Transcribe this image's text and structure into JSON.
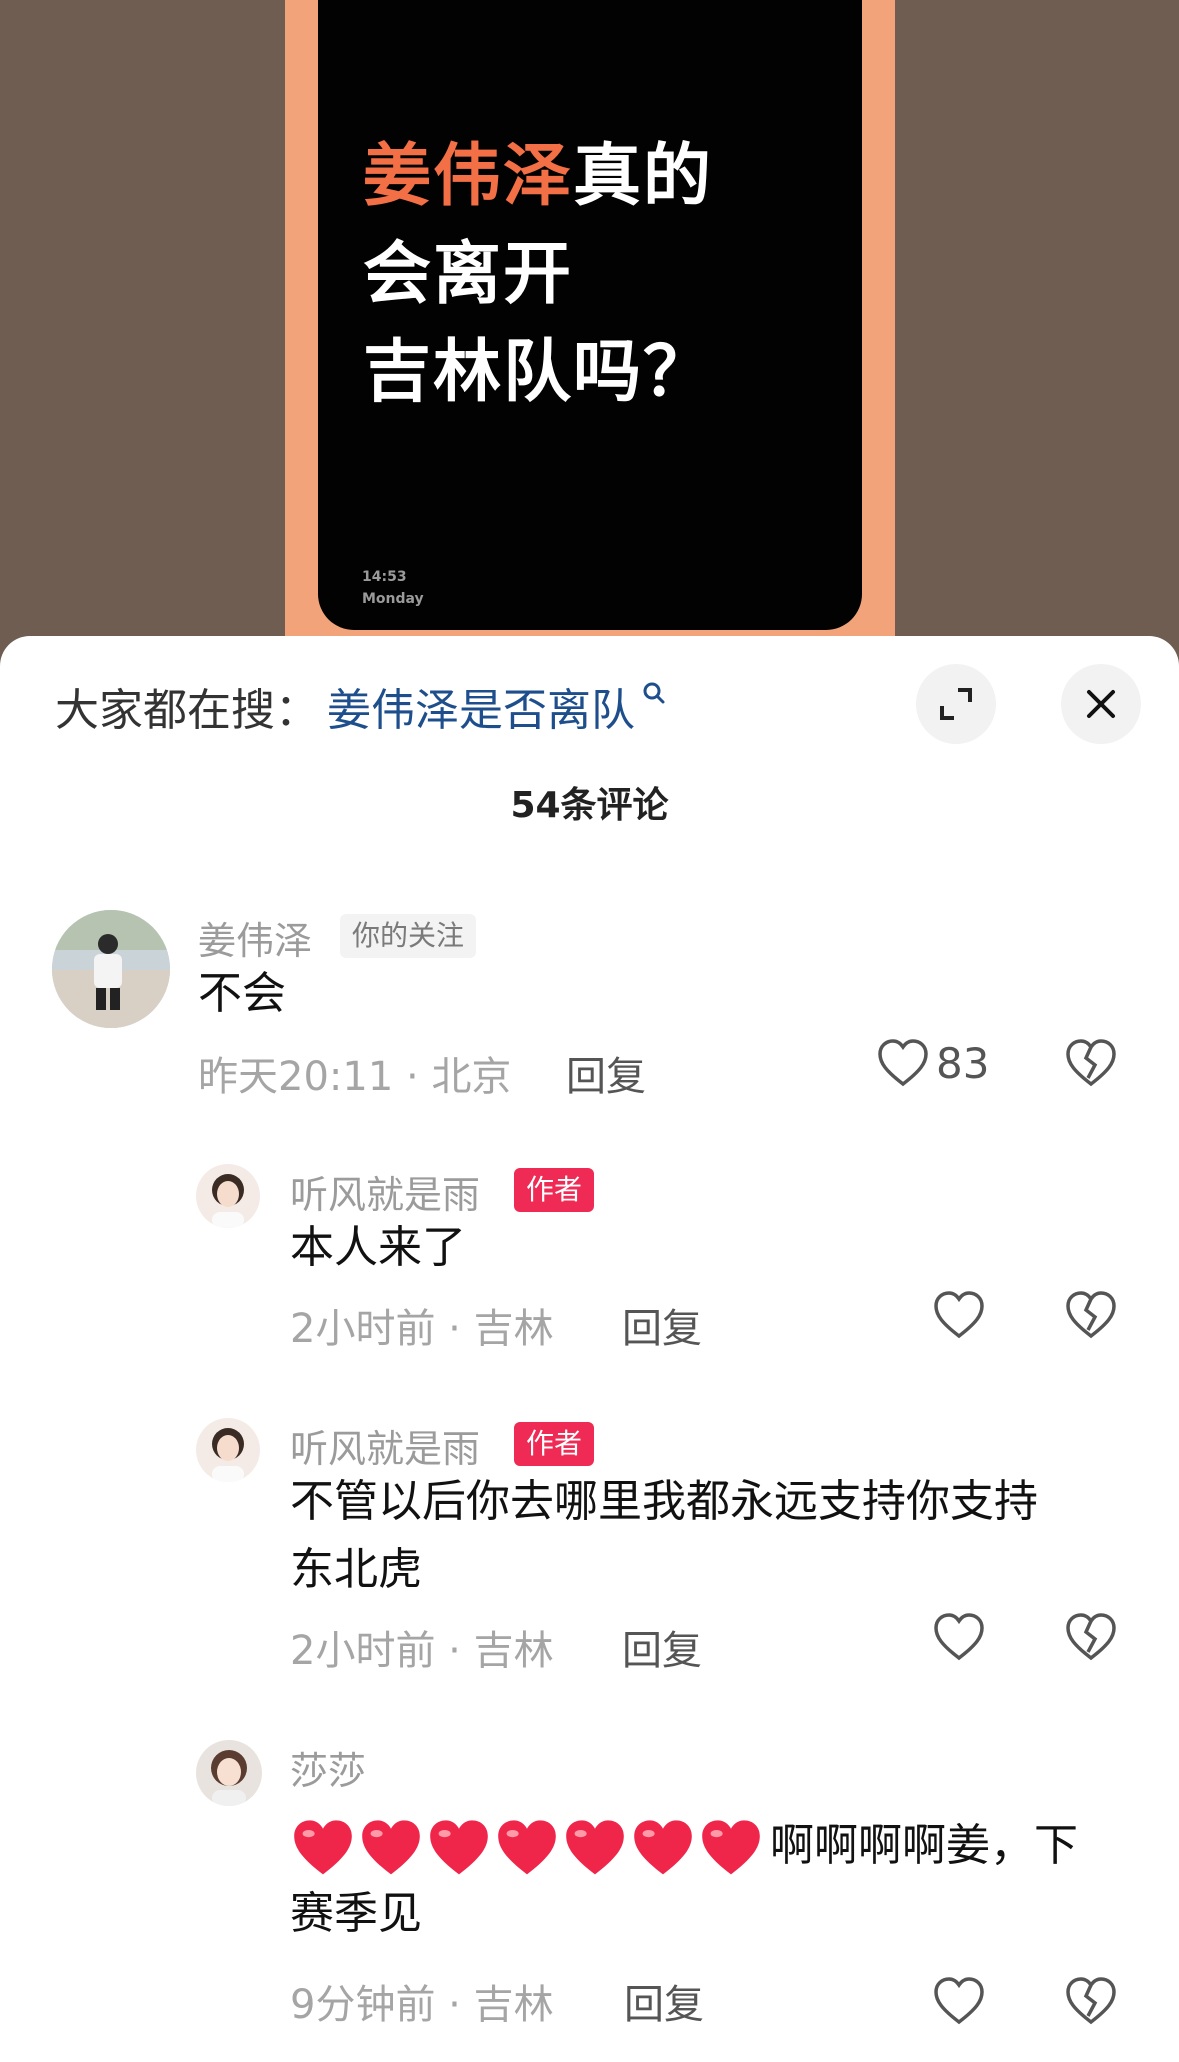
{
  "video": {
    "headline_highlight": "姜伟泽",
    "headline_rest_line1": "真的",
    "headline_line2": "会离开",
    "headline_line3": "吉林队吗？",
    "clock_time": "14:53",
    "clock_day": "Monday"
  },
  "search": {
    "prefix": "大家都在搜：",
    "term": "姜伟泽是否离队"
  },
  "comment_count": "54条评论",
  "comments": [
    {
      "username": "姜伟泽",
      "tag": "你的关注",
      "text": "不会",
      "time": "昨天20:11",
      "location": "北京",
      "reply": "回复",
      "likes": "83"
    },
    {
      "username": "听风就是雨",
      "tag": "作者",
      "text": "本人来了",
      "time": "2小时前",
      "location": "吉林",
      "reply": "回复"
    },
    {
      "username": "听风就是雨",
      "tag": "作者",
      "text_line1": "不管以后你去哪里我都永远支持你支持",
      "text_line2": "东北虎",
      "time": "2小时前",
      "location": "吉林",
      "reply": "回复"
    },
    {
      "username": "莎莎",
      "heart_count": 7,
      "text_line1": "啊啊啊啊姜，下",
      "text_line2": "赛季见",
      "time": "9分钟前",
      "location": "吉林",
      "reply": "回复"
    }
  ],
  "colors": {
    "accent_orange": "#f36f45",
    "search_term_blue": "#1e4f8c",
    "author_tag": "#ee2a55",
    "heart_red": "#f0254a"
  },
  "icons": [
    "search-icon",
    "expand-icon",
    "close-icon",
    "like-icon",
    "dislike-icon",
    "heart-emoji"
  ]
}
